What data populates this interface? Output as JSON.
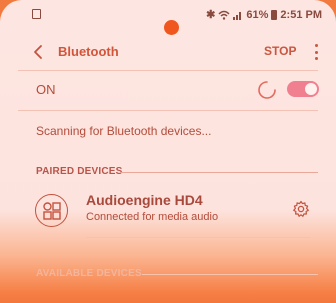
{
  "status_bar": {
    "battery": "61%",
    "time": "2:51 PM",
    "icons": [
      "bluetooth-icon",
      "wifi-icon",
      "signal-icon",
      "battery-icon"
    ]
  },
  "app_bar": {
    "title": "Bluetooth",
    "stop_label": "STOP"
  },
  "toggle_row": {
    "label": "ON",
    "enabled": true
  },
  "scanning_text": "Scanning for Bluetooth devices...",
  "sections": {
    "paired_header": "PAIRED DEVICES",
    "available_header": "AVAILABLE DEVICES"
  },
  "paired_devices": [
    {
      "name": "Audioengine HD4",
      "status": "Connected for media audio"
    }
  ],
  "colors": {
    "accent": "#d2553a",
    "toggle": "#f08090",
    "background_top": "#fde6e2",
    "background_bottom": "#f4773b"
  }
}
